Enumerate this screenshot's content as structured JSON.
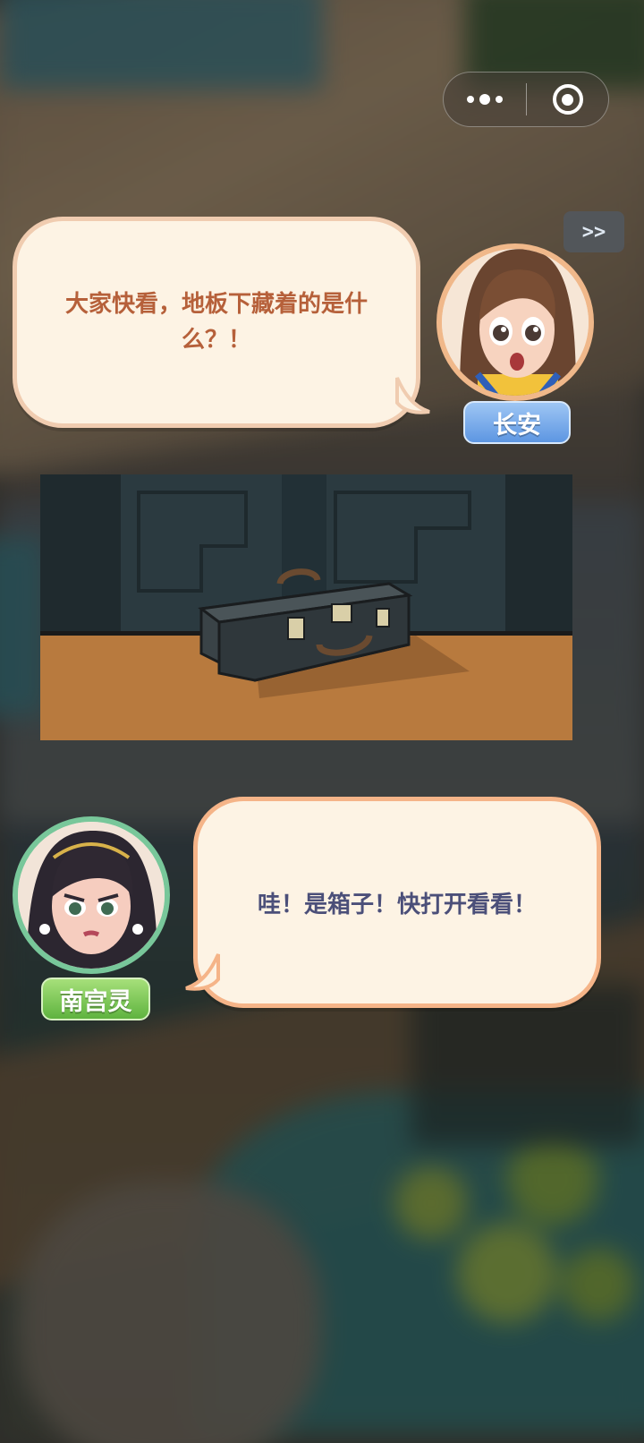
{
  "capsule": {
    "more_icon": "more-dots-icon",
    "close_icon": "target-close-icon"
  },
  "skip": {
    "label": ">>"
  },
  "dialogue": [
    {
      "speaker": "长安",
      "text": "大家快看，地板下藏着的是什么？！",
      "nameplate_color": "#6aa1e6",
      "ring_color": "#f0b88a"
    },
    {
      "speaker": "南宫灵",
      "text": "哇！是箱子！快打开看看！",
      "nameplate_color": "#6cbd47",
      "ring_color": "#78c79a"
    }
  ],
  "scene_image": {
    "subject": "suitcase-on-floor",
    "wall_color": "#2b3a40",
    "floor_color": "#b87a3e"
  }
}
